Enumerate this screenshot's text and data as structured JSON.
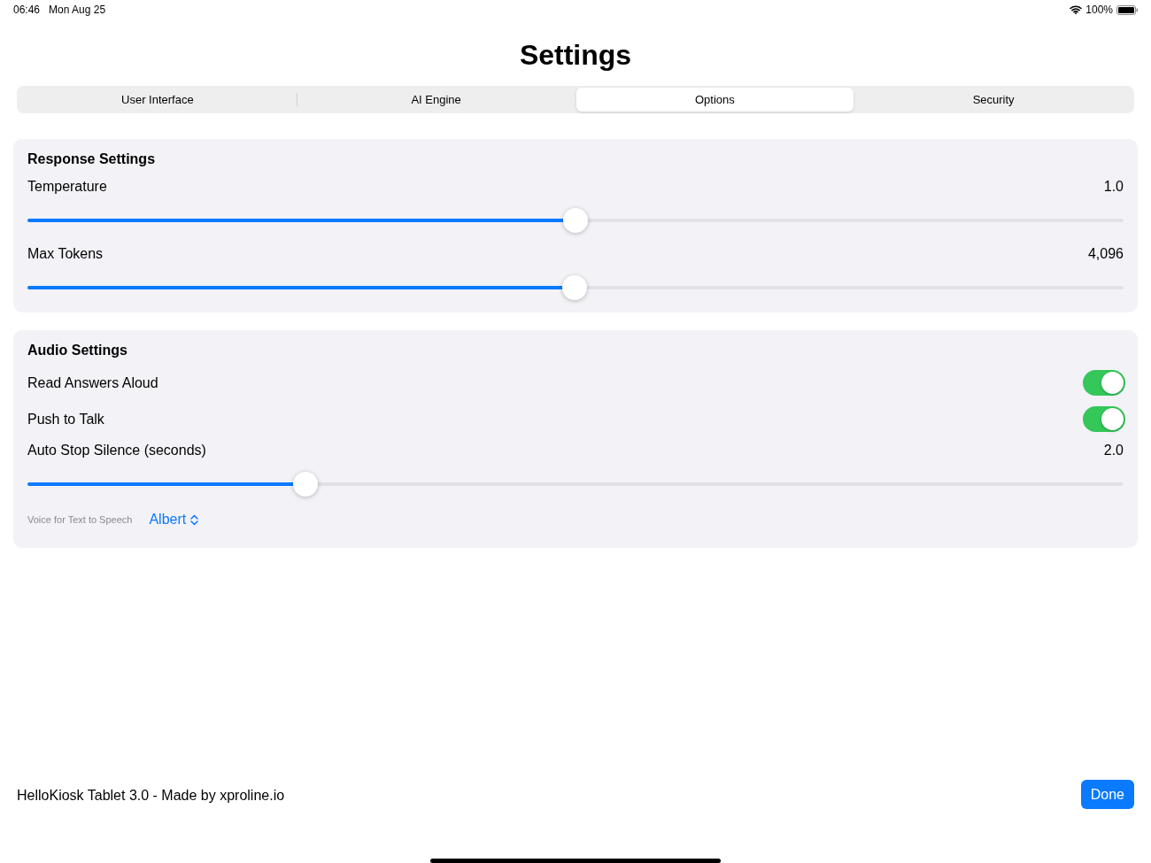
{
  "status_bar": {
    "time": "06:46",
    "date": "Mon Aug 25",
    "battery": "100%"
  },
  "title": "Settings",
  "tabs": [
    {
      "label": "User Interface",
      "selected": false
    },
    {
      "label": "AI Engine",
      "selected": false
    },
    {
      "label": "Options",
      "selected": true
    },
    {
      "label": "Security",
      "selected": false
    }
  ],
  "sections": [
    {
      "title": "Response Settings",
      "items": [
        {
          "kind": "slider",
          "label": "Temperature",
          "reading": "1.0",
          "level": 0.5
        },
        {
          "kind": "slider",
          "label": "Max Tokens",
          "reading": "4,096",
          "level": 0.499
        }
      ]
    },
    {
      "title": "Audio Settings",
      "items": [
        {
          "kind": "toggle",
          "label": "Read Answers Aloud",
          "on": true
        },
        {
          "kind": "toggle",
          "label": "Push to Talk",
          "on": true
        },
        {
          "kind": "slider",
          "label": "Auto Stop Silence (seconds)",
          "reading": "2.0",
          "level": 0.254
        },
        {
          "kind": "picker",
          "label": "Voice for Text to Speech",
          "value": "Albert"
        }
      ]
    }
  ],
  "footer": {
    "text": "HelloKiosk Tablet 3.0 - Made by xproline.io",
    "button": "Done"
  }
}
